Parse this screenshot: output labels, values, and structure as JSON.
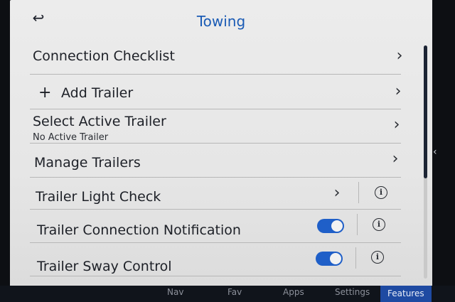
{
  "header": {
    "title": "Towing",
    "back_icon": "back-arrow-icon"
  },
  "rows": [
    {
      "label": "Connection Checklist"
    },
    {
      "label": "Add Trailer",
      "prefix": "+"
    },
    {
      "label": "Select Active Trailer",
      "sublabel": "No Active Trailer"
    },
    {
      "label": "Manage Trailers"
    },
    {
      "label": "Trailer Light Check",
      "info": "i"
    },
    {
      "label": "Trailer Connection Notification",
      "toggle": "on",
      "info": "i"
    },
    {
      "label": "Trailer Sway Control",
      "toggle": "on",
      "info": "i"
    }
  ],
  "chevron": "›",
  "side_chevron": "‹",
  "scroll": {
    "thumb_fraction": 0.57
  },
  "colors": {
    "accent": "#1a5bb5",
    "toggle_on": "#1f5fc8",
    "nav_active": "#1e4aa2"
  },
  "bottom_nav": {
    "items": [
      {
        "label": "Nav"
      },
      {
        "label": "Fav"
      },
      {
        "label": "Apps"
      },
      {
        "label": "Settings"
      },
      {
        "label": "Features"
      }
    ],
    "active": "Features"
  }
}
